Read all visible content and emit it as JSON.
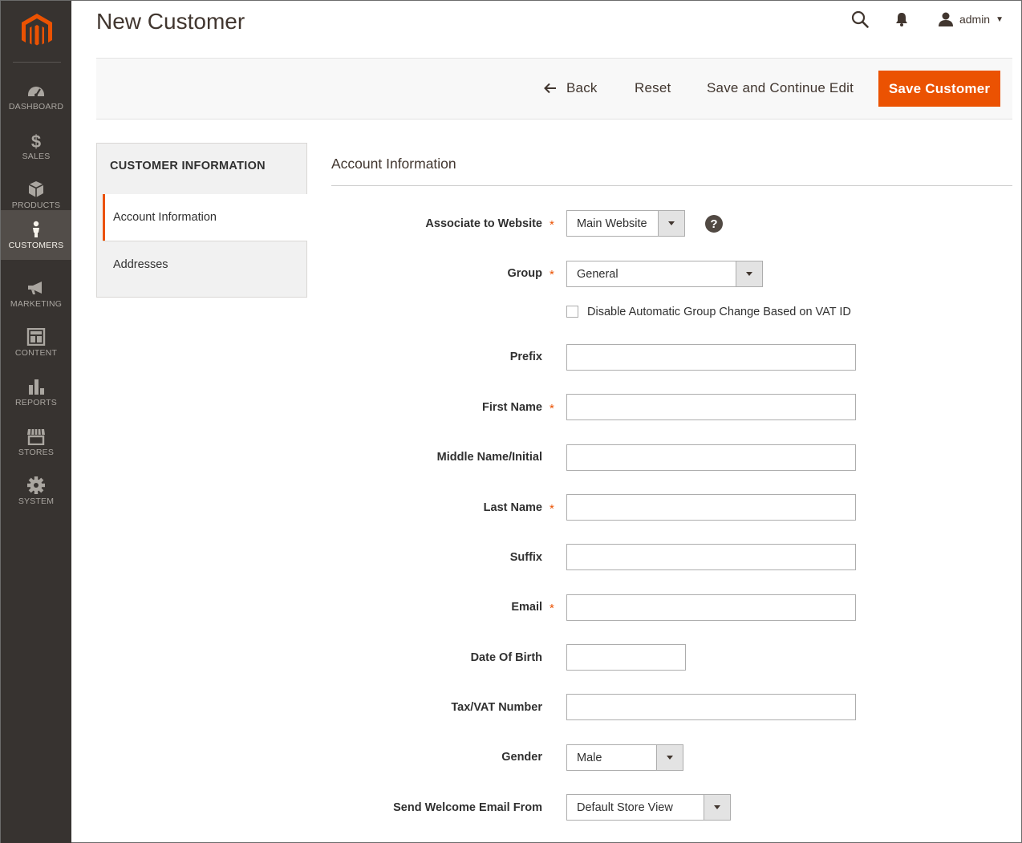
{
  "sidebar": {
    "items": [
      {
        "label": "DASHBOARD",
        "icon": "dashboard-icon"
      },
      {
        "label": "SALES",
        "icon": "dollar-icon"
      },
      {
        "label": "PRODUCTS",
        "icon": "box-icon"
      },
      {
        "label": "CUSTOMERS",
        "icon": "person-icon"
      },
      {
        "label": "MARKETING",
        "icon": "megaphone-icon"
      },
      {
        "label": "CONTENT",
        "icon": "layout-icon"
      },
      {
        "label": "REPORTS",
        "icon": "bar-chart-icon"
      },
      {
        "label": "STORES",
        "icon": "storefront-icon"
      },
      {
        "label": "SYSTEM",
        "icon": "gear-icon"
      }
    ],
    "active_index": 3
  },
  "header": {
    "title": "New Customer",
    "user": "admin"
  },
  "actions": {
    "back": "Back",
    "reset": "Reset",
    "save_continue": "Save and Continue Edit",
    "save": "Save Customer"
  },
  "tabs": {
    "title": "CUSTOMER INFORMATION",
    "items": [
      "Account Information",
      "Addresses"
    ],
    "active": "Account Information"
  },
  "form": {
    "section_title": "Account Information",
    "associate_website": {
      "label": "Associate to Website",
      "value": "Main Website",
      "required": true
    },
    "group": {
      "label": "Group",
      "value": "General",
      "required": true
    },
    "disable_group_change": {
      "label": "Disable Automatic Group Change Based on VAT ID",
      "checked": false
    },
    "prefix": {
      "label": "Prefix",
      "value": ""
    },
    "first_name": {
      "label": "First Name",
      "value": "",
      "required": true
    },
    "middle_name": {
      "label": "Middle Name/Initial",
      "value": ""
    },
    "last_name": {
      "label": "Last Name",
      "value": "",
      "required": true
    },
    "suffix": {
      "label": "Suffix",
      "value": ""
    },
    "email": {
      "label": "Email",
      "value": "",
      "required": true
    },
    "dob": {
      "label": "Date Of Birth",
      "value": ""
    },
    "taxvat": {
      "label": "Tax/VAT Number",
      "value": ""
    },
    "gender": {
      "label": "Gender",
      "value": "Male"
    },
    "welcome_from": {
      "label": "Send Welcome Email From",
      "value": "Default Store View"
    },
    "required_mark": "*",
    "help_mark": "?"
  },
  "colors": {
    "accent": "#eb5202",
    "sidebar_bg": "#373330",
    "sidebar_active": "#524d49"
  }
}
